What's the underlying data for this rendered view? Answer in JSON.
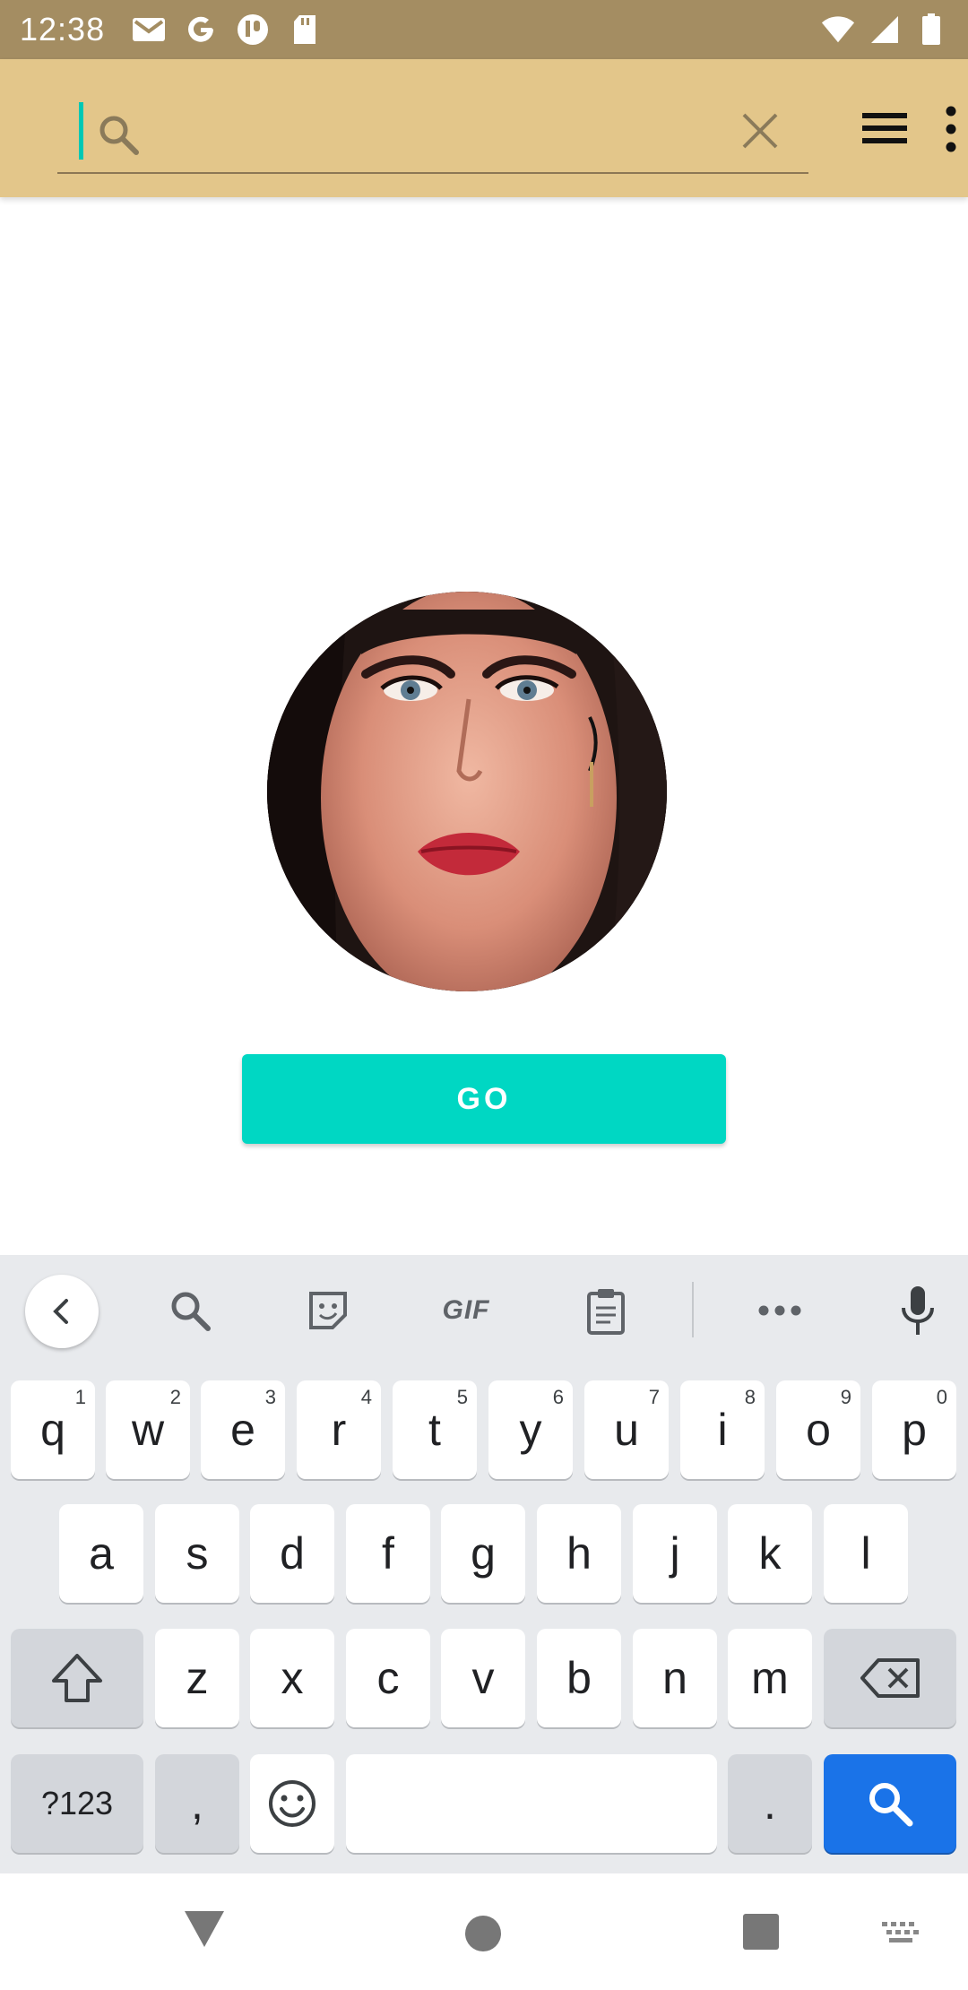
{
  "status_bar": {
    "time": "12:38",
    "left_icons": [
      "gmail-icon",
      "google-icon",
      "app-icon",
      "sd-card-icon"
    ],
    "right_icons": [
      "wifi-icon",
      "signal-icon",
      "battery-icon"
    ]
  },
  "app_bar": {
    "search": {
      "value": "",
      "placeholder": ""
    }
  },
  "main": {
    "go_label": "GO"
  },
  "keyboard": {
    "toolbar": [
      "back-icon",
      "search-icon",
      "sticker-icon",
      "gif",
      "clipboard-icon",
      "more-icon",
      "mic-icon"
    ],
    "gif_label": "GIF",
    "row1": [
      {
        "k": "q",
        "h": "1"
      },
      {
        "k": "w",
        "h": "2"
      },
      {
        "k": "e",
        "h": "3"
      },
      {
        "k": "r",
        "h": "4"
      },
      {
        "k": "t",
        "h": "5"
      },
      {
        "k": "y",
        "h": "6"
      },
      {
        "k": "u",
        "h": "7"
      },
      {
        "k": "i",
        "h": "8"
      },
      {
        "k": "o",
        "h": "9"
      },
      {
        "k": "p",
        "h": "0"
      }
    ],
    "row2": [
      "a",
      "s",
      "d",
      "f",
      "g",
      "h",
      "j",
      "k",
      "l"
    ],
    "row3": [
      "z",
      "x",
      "c",
      "v",
      "b",
      "n",
      "m"
    ],
    "symbols_label": "?123",
    "comma_label": ",",
    "period_label": "."
  },
  "colors": {
    "status_bar": "#a48d62",
    "app_bar": "#e3c68a",
    "accent": "#00d7c3",
    "keyboard_bg": "#e8eaed",
    "action_key": "#1a73e8"
  }
}
